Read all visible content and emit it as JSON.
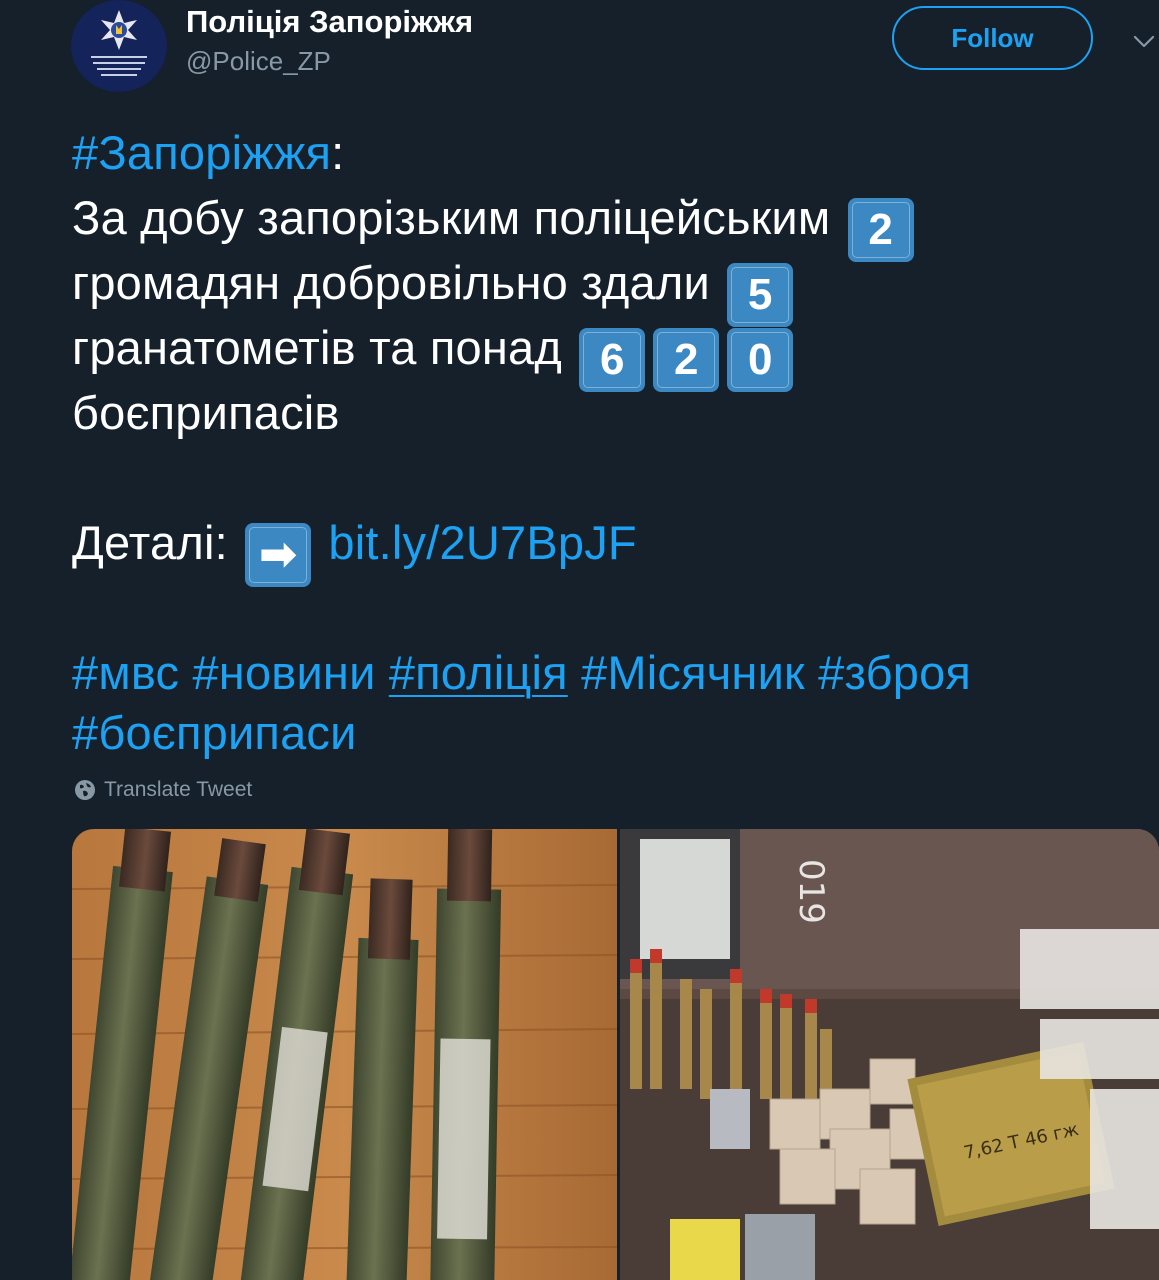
{
  "header": {
    "display_name": "Поліція Запоріжжя",
    "handle": "@Police_ZP",
    "follow_label": "Follow"
  },
  "tweet": {
    "line1_hashtag": "#Запоріжжя",
    "line1_colon": ":",
    "line2_text": "За добу запорізьким поліцейським",
    "line2_num": "2",
    "line3_text": "громадян добровільно здали",
    "line3_num": "5",
    "line4_text": "гранатометів та понад",
    "line4_digits": [
      "6",
      "2",
      "0"
    ],
    "line5_text": "боєприпасів",
    "details_label": "Деталі:",
    "details_arrow": "➡",
    "details_link": "bit.ly/2U7BpJF",
    "hashtags_row1": [
      "#мвс",
      "#новини",
      "#поліція",
      "#Місячник",
      "#зброя"
    ],
    "hashtags_row2": [
      "#боєприпаси"
    ]
  },
  "translate_label": "Translate Tweet",
  "colors": {
    "background": "#15202b",
    "accent": "#1da1f2",
    "secondary_text": "#8899a6",
    "keycap": "#3b88c3"
  },
  "icons": {
    "avatar": "police-badge-logo",
    "menu": "chevron-down-icon",
    "translate": "globe-icon",
    "arrow": "right-arrow-emoji"
  }
}
